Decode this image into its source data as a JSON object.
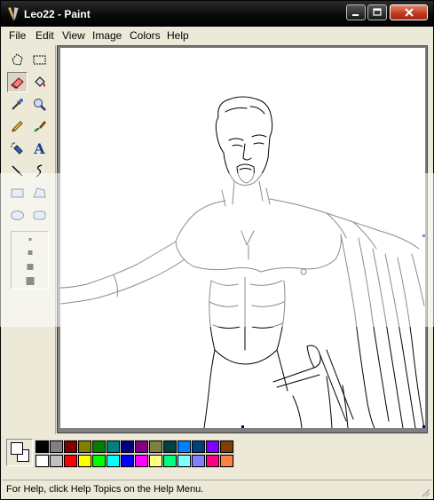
{
  "window": {
    "title": "Leo22 - Paint",
    "buttons": {
      "minimize_icon": "minimize-icon",
      "maximize_icon": "maximize-icon",
      "close_icon": "close-icon"
    }
  },
  "menu": {
    "items": [
      "File",
      "Edit",
      "View",
      "Image",
      "Colors",
      "Help"
    ]
  },
  "toolbox": {
    "tools": [
      {
        "name": "free-form-select-icon"
      },
      {
        "name": "select-icon"
      },
      {
        "name": "eraser-icon",
        "active": true
      },
      {
        "name": "fill-icon"
      },
      {
        "name": "pick-color-icon"
      },
      {
        "name": "magnifier-icon"
      },
      {
        "name": "pencil-icon"
      },
      {
        "name": "brush-icon"
      },
      {
        "name": "airbrush-icon"
      },
      {
        "name": "text-icon",
        "glyph": "A"
      },
      {
        "name": "line-icon"
      },
      {
        "name": "curve-icon"
      },
      {
        "name": "rectangle-icon"
      },
      {
        "name": "polygon-icon"
      },
      {
        "name": "ellipse-icon"
      },
      {
        "name": "rounded-rectangle-icon"
      }
    ],
    "brush_sizes": 4
  },
  "palette": {
    "top": [
      "#000000",
      "#808080",
      "#800000",
      "#808000",
      "#008000",
      "#008080",
      "#000080",
      "#800080",
      "#808040",
      "#004040",
      "#0080ff",
      "#004080",
      "#8000ff",
      "#804000"
    ],
    "bottom": [
      "#ffffff",
      "#c0c0c0",
      "#ff0000",
      "#ffff00",
      "#00ff00",
      "#00ffff",
      "#0000ff",
      "#ff00ff",
      "#ffff80",
      "#00ff80",
      "#80ffff",
      "#8080ff",
      "#ff0080",
      "#ff8040"
    ],
    "foreground": "#ffffff",
    "background": "#ffffff"
  },
  "status": {
    "text": "For Help, click Help Topics on the Help Menu."
  }
}
